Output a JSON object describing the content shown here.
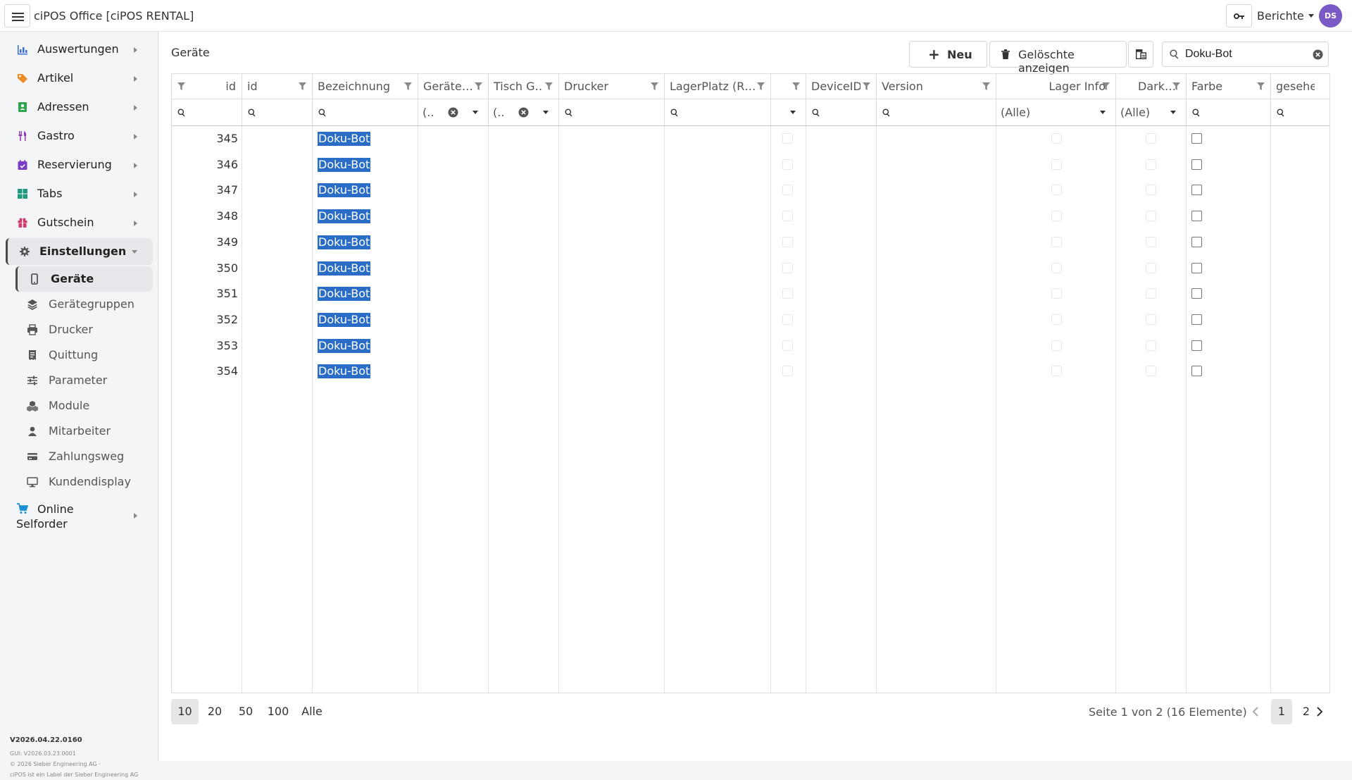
{
  "app": {
    "title": "ciPOS Office [ciPOS RENTAL]"
  },
  "topbar": {
    "reports_label": "Berichte",
    "avatar_initials": "DS",
    "avatar_color": "#7a5ac5"
  },
  "sidebar": {
    "items": [
      {
        "label": "Auswertungen",
        "icon": "bar-chart-icon",
        "color": "#3b6fd4"
      },
      {
        "label": "Artikel",
        "icon": "tags-icon",
        "color": "#f08c2a"
      },
      {
        "label": "Adressen",
        "icon": "address-book-icon",
        "color": "#2ea44f"
      },
      {
        "label": "Gastro",
        "icon": "utensils-icon",
        "color": "#8e3bb8"
      },
      {
        "label": "Reservierung",
        "icon": "calendar-check-icon",
        "color": "#7a3cc8"
      },
      {
        "label": "Tabs",
        "icon": "grid-icon",
        "color": "#1f9a7a"
      },
      {
        "label": "Gutschein",
        "icon": "gift-icon",
        "color": "#d63a6a"
      },
      {
        "label": "Einstellungen",
        "icon": "gear-icon",
        "color": "#555555"
      }
    ],
    "subitems": [
      {
        "label": "Geräte",
        "icon": "mobile-icon"
      },
      {
        "label": "Gerätegruppen",
        "icon": "layers-icon"
      },
      {
        "label": "Drucker",
        "icon": "printer-icon"
      },
      {
        "label": "Quittung",
        "icon": "receipt-icon"
      },
      {
        "label": "Parameter",
        "icon": "sliders-icon"
      },
      {
        "label": "Module",
        "icon": "cubes-icon"
      },
      {
        "label": "Mitarbeiter",
        "icon": "user-icon"
      },
      {
        "label": "Zahlungsweg",
        "icon": "credit-card-icon"
      },
      {
        "label": "Kundendisplay",
        "icon": "monitor-icon"
      }
    ],
    "online": {
      "line1": "Online",
      "line2": "Selforder",
      "icon": "cart-icon",
      "color": "#1a8fd6"
    }
  },
  "version": {
    "main": "V2026.04.22.0160",
    "gui": "GUI: V2026.03.23.0001",
    "copyright": "© 2026 Sieber Engineering AG ·",
    "label": "ciPOS ist ein Label der Sieber Engineering AG"
  },
  "page": {
    "title": "Geräte"
  },
  "toolbar": {
    "new_label": "Neu",
    "deleted_label": "Gelöschte anzeigen",
    "search_value": "Doku-Bot"
  },
  "grid": {
    "columns": [
      "id",
      "id",
      "Bezeichnung",
      "Geräte…",
      "Tisch G…",
      "Drucker",
      "LagerPlatz (R…",
      "",
      "DeviceID",
      "Version",
      "Lager Info",
      "Dark…",
      "Farbe",
      "gesehen"
    ],
    "filters": {
      "dropdown_short": "(..",
      "all": "(Alle)"
    },
    "rows": [
      {
        "id": "345",
        "name": "Doku-Bot"
      },
      {
        "id": "346",
        "name": "Doku-Bot"
      },
      {
        "id": "347",
        "name": "Doku-Bot"
      },
      {
        "id": "348",
        "name": "Doku-Bot"
      },
      {
        "id": "349",
        "name": "Doku-Bot"
      },
      {
        "id": "350",
        "name": "Doku-Bot"
      },
      {
        "id": "351",
        "name": "Doku-Bot"
      },
      {
        "id": "352",
        "name": "Doku-Bot"
      },
      {
        "id": "353",
        "name": "Doku-Bot"
      },
      {
        "id": "354",
        "name": "Doku-Bot"
      }
    ]
  },
  "pager": {
    "sizes": [
      "10",
      "20",
      "50",
      "100",
      "Alle"
    ],
    "info": "Seite 1 von 2 (16 Elemente)",
    "pages": [
      "1",
      "2"
    ]
  }
}
